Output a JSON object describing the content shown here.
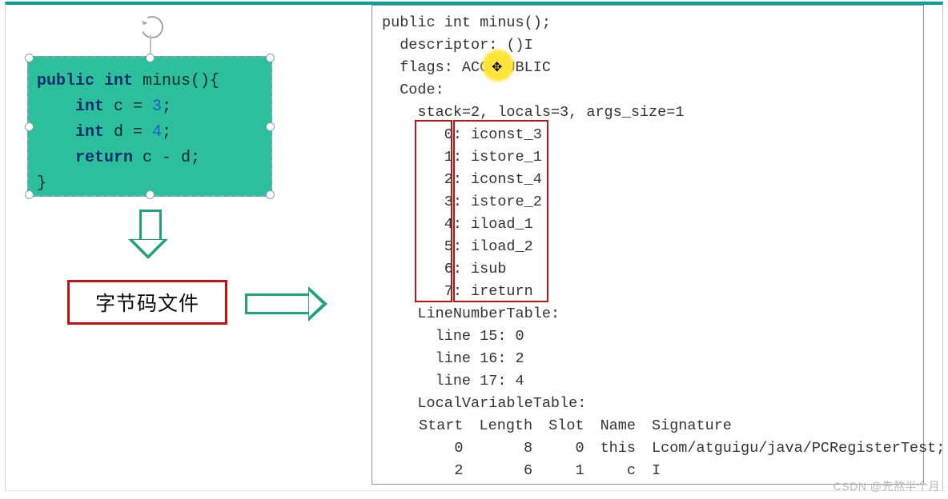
{
  "source_code": {
    "header": "public int minus(){",
    "line1_kw": "int",
    "line1_rest": " c = ",
    "line1_num": "3",
    "line2_kw": "int",
    "line2_rest": " d = ",
    "line2_num": "4",
    "line3_kw": "return",
    "line3_rest": " c - d;",
    "footer": "}"
  },
  "label_box": "字节码文件",
  "dump": {
    "sig": "public int minus();",
    "descriptor_label": "  descriptor: ",
    "descriptor_value": "()I",
    "flags_label": "  flags: ",
    "flags_value": "ACC_PUBLIC",
    "code_label": "  Code:",
    "stack_line": "    stack=2, locals=3, args_size=1",
    "instructions": [
      {
        "off": "0",
        "op": "iconst_3"
      },
      {
        "off": "1",
        "op": "istore_1"
      },
      {
        "off": "2",
        "op": "iconst_4"
      },
      {
        "off": "3",
        "op": "istore_2"
      },
      {
        "off": "4",
        "op": "iload_1"
      },
      {
        "off": "5",
        "op": "iload_2"
      },
      {
        "off": "6",
        "op": "isub"
      },
      {
        "off": "7",
        "op": "ireturn"
      }
    ],
    "lnt_label": "    LineNumberTable:",
    "lnt": [
      "      line 15: 0",
      "      line 16: 2",
      "      line 17: 4"
    ],
    "lvt_label": "    LocalVariableTable:",
    "lvt_header": [
      "Start",
      "Length",
      "Slot",
      "Name",
      "Signature"
    ],
    "lvt_rows": [
      [
        "0",
        "8",
        "0",
        "this",
        "Lcom/atguigu/java/PCRegisterTest;"
      ],
      [
        "2",
        "6",
        "1",
        "c",
        "I"
      ]
    ]
  },
  "watermark": "CSDN @先熬半个月"
}
